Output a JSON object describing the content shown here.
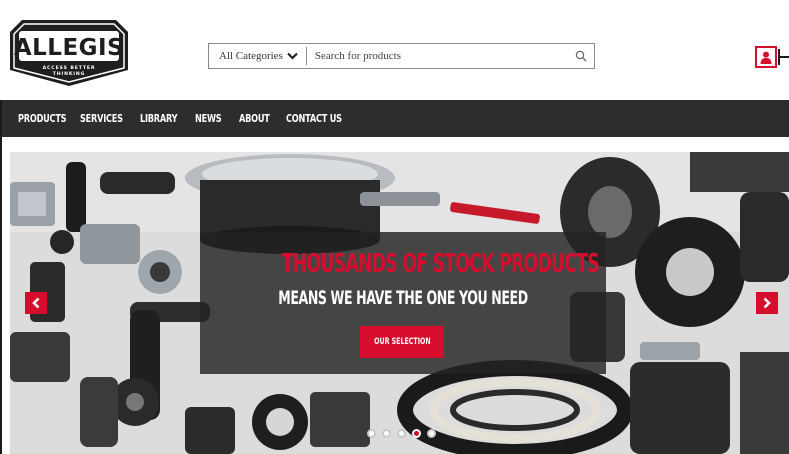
{
  "brand": {
    "name": "ALLEGIS",
    "tagline_1": "ACCESS BETTER",
    "tagline_2": "THINKING"
  },
  "search": {
    "category_label": "All Categories",
    "placeholder": "Search for products",
    "value": ""
  },
  "icons": {
    "search": "search-icon",
    "user": "user-icon",
    "chevron": "chevron-down-icon",
    "prev": "chevron-left-icon",
    "next": "chevron-right-icon"
  },
  "nav": {
    "items": [
      "PRODUCTS",
      "SERVICES",
      "LIBRARY",
      "NEWS",
      "ABOUT",
      "CONTACT US"
    ]
  },
  "hero": {
    "headline": "THOUSANDS OF STOCK PRODUCTS",
    "subheadline": "MEANS WE HAVE THE ONE YOU NEED",
    "cta_label": "OUR SELECTION",
    "slide_count": 5,
    "active_slide": 4
  },
  "colors": {
    "accent": "#d60d2c",
    "nav_bg": "#2d2d2d",
    "overlay_bg": "#232323"
  }
}
